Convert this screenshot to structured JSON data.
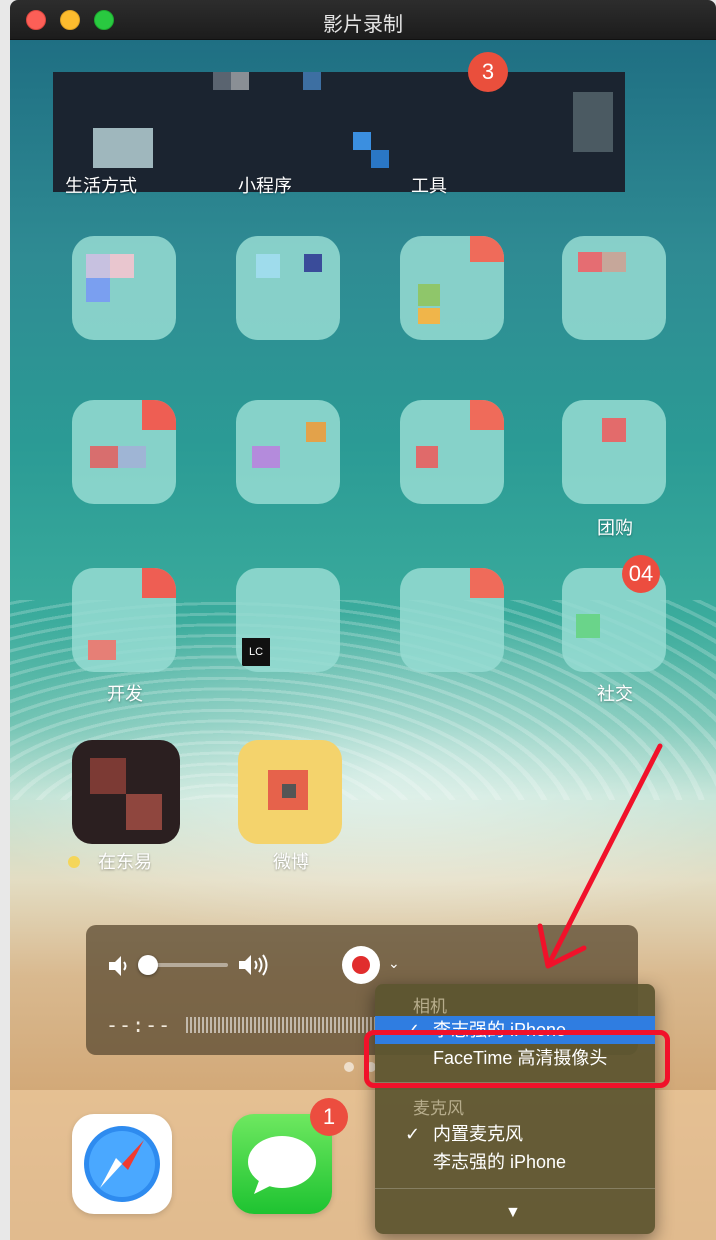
{
  "window": {
    "title": "影片录制"
  },
  "home_screen": {
    "top_badge": "3",
    "row_labels_top": [
      "生活方式",
      "小程序",
      "工具"
    ],
    "labels": {
      "tuangou": "团购",
      "kaifa": "开发",
      "shejiao": "社交",
      "zaidongyi": "在东易",
      "weibo": "微博"
    },
    "badge_04": "04",
    "lc_tile": "LC",
    "messages_badge": "1"
  },
  "recorder": {
    "time": "--:--",
    "icons": [
      "volume-low-icon",
      "volume-high-icon",
      "record-icon",
      "chevron-down-icon"
    ]
  },
  "dropdown_menu": {
    "camera_header": "相机",
    "camera_items": [
      {
        "label": "李志强的 iPhone",
        "checked": true,
        "selected": true
      },
      {
        "label": "FaceTime 高清摄像头",
        "checked": false,
        "selected": false
      }
    ],
    "mic_header": "麦克风",
    "mic_items": [
      {
        "label": "内置麦克风",
        "checked": true
      },
      {
        "label": "李志强的 iPhone",
        "checked": false
      }
    ],
    "more_icon": "triangle-down-icon"
  },
  "colors": {
    "highlight": "#f1112a",
    "menu_selected": "#2f7de1",
    "record": "#e12d2d"
  }
}
